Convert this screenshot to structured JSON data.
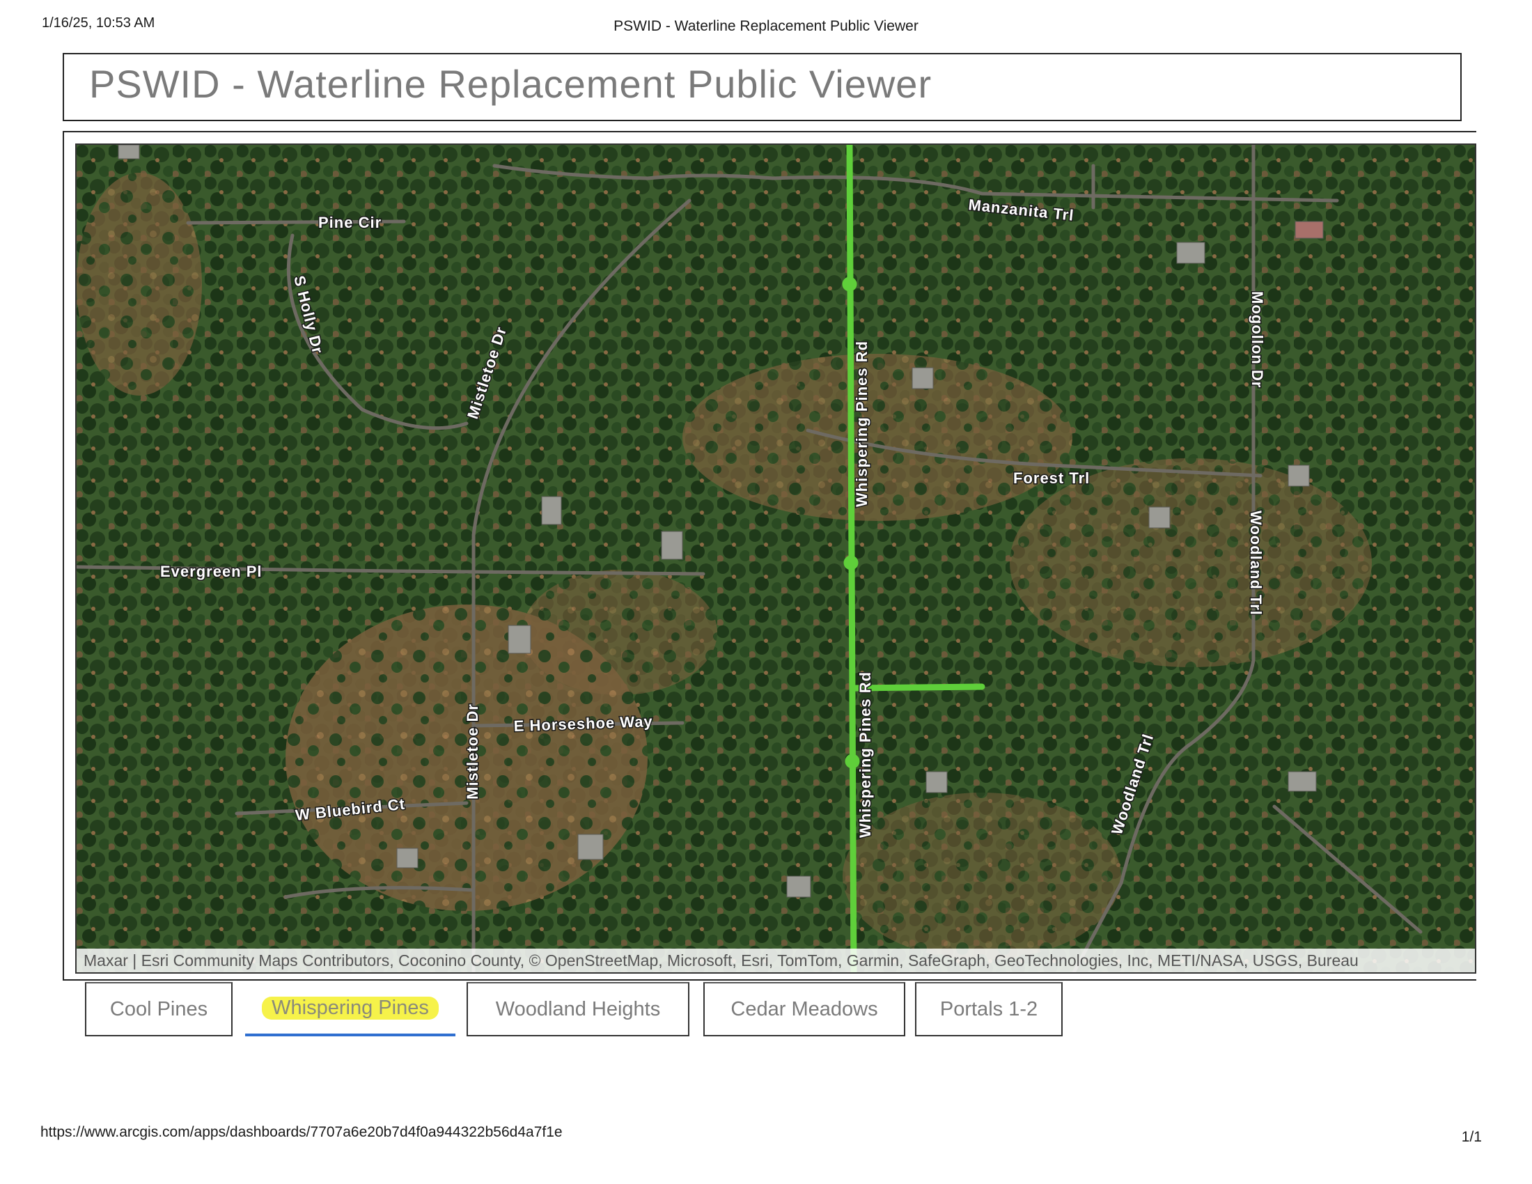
{
  "print_header": {
    "datetime": "1/16/25, 10:53 AM",
    "doc_title": "PSWID - Waterline Replacement Public Viewer"
  },
  "print_footer": {
    "url": "https://www.arcgis.com/apps/dashboards/7707a6e20b7d4f0a944322b56d4a7f1e",
    "page": "1/1"
  },
  "dashboard": {
    "title": "PSWID - Waterline Replacement Public Viewer"
  },
  "map": {
    "attribution": "Maxar | Esri Community Maps Contributors, Coconino County, © OpenStreetMap, Microsoft, Esri, TomTom, Garmin, SafeGraph, GeoTechnologies, Inc, METI/NASA, USGS, Bureau",
    "waterline_color": "#5fcf3a",
    "streets": {
      "manzanita": "Manzanita Trl",
      "pine_cir": "Pine Cir",
      "s_holly": "S Holly Dr",
      "mistletoe_north": "Mistletoe Dr",
      "whispering_north": "Whispering Pines Rd",
      "mogollon": "Mogollon Dr",
      "forest": "Forest Trl",
      "woodland_north": "Woodland Trl",
      "evergreen": "Evergreen Pl",
      "horseshoe": "E Horseshoe Way",
      "mistletoe_south": "Mistletoe Dr",
      "whispering_south": "Whispering Pines Rd",
      "bluebird": "W Bluebird Ct",
      "woodland_south": "Woodland Trl"
    }
  },
  "tabs": [
    {
      "label": "Cool Pines",
      "active": false
    },
    {
      "label": "Whispering Pines",
      "active": true
    },
    {
      "label": "Woodland Heights",
      "active": false
    },
    {
      "label": "Cedar Meadows",
      "active": false
    },
    {
      "label": "Portals 1-2",
      "active": false
    }
  ]
}
